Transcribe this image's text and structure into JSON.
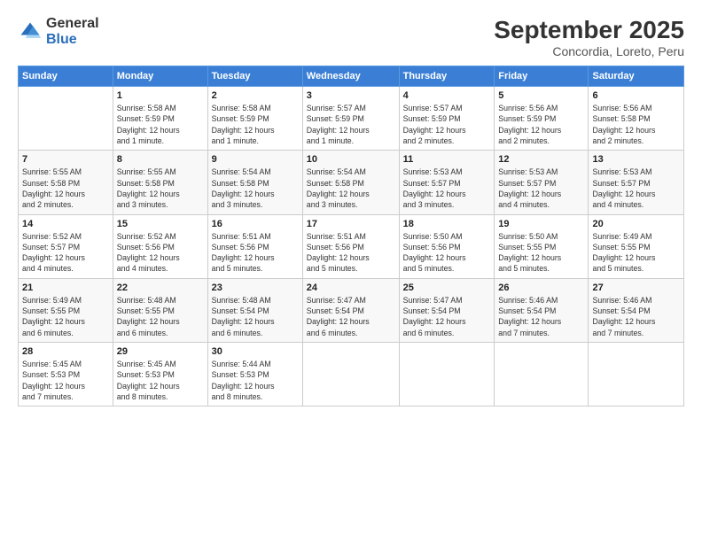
{
  "header": {
    "logo_general": "General",
    "logo_blue": "Blue",
    "month_title": "September 2025",
    "location": "Concordia, Loreto, Peru"
  },
  "weekdays": [
    "Sunday",
    "Monday",
    "Tuesday",
    "Wednesday",
    "Thursday",
    "Friday",
    "Saturday"
  ],
  "weeks": [
    [
      {
        "day": "",
        "info": ""
      },
      {
        "day": "1",
        "info": "Sunrise: 5:58 AM\nSunset: 5:59 PM\nDaylight: 12 hours\nand 1 minute."
      },
      {
        "day": "2",
        "info": "Sunrise: 5:58 AM\nSunset: 5:59 PM\nDaylight: 12 hours\nand 1 minute."
      },
      {
        "day": "3",
        "info": "Sunrise: 5:57 AM\nSunset: 5:59 PM\nDaylight: 12 hours\nand 1 minute."
      },
      {
        "day": "4",
        "info": "Sunrise: 5:57 AM\nSunset: 5:59 PM\nDaylight: 12 hours\nand 2 minutes."
      },
      {
        "day": "5",
        "info": "Sunrise: 5:56 AM\nSunset: 5:59 PM\nDaylight: 12 hours\nand 2 minutes."
      },
      {
        "day": "6",
        "info": "Sunrise: 5:56 AM\nSunset: 5:58 PM\nDaylight: 12 hours\nand 2 minutes."
      }
    ],
    [
      {
        "day": "7",
        "info": "Sunrise: 5:55 AM\nSunset: 5:58 PM\nDaylight: 12 hours\nand 2 minutes."
      },
      {
        "day": "8",
        "info": "Sunrise: 5:55 AM\nSunset: 5:58 PM\nDaylight: 12 hours\nand 3 minutes."
      },
      {
        "day": "9",
        "info": "Sunrise: 5:54 AM\nSunset: 5:58 PM\nDaylight: 12 hours\nand 3 minutes."
      },
      {
        "day": "10",
        "info": "Sunrise: 5:54 AM\nSunset: 5:58 PM\nDaylight: 12 hours\nand 3 minutes."
      },
      {
        "day": "11",
        "info": "Sunrise: 5:53 AM\nSunset: 5:57 PM\nDaylight: 12 hours\nand 3 minutes."
      },
      {
        "day": "12",
        "info": "Sunrise: 5:53 AM\nSunset: 5:57 PM\nDaylight: 12 hours\nand 4 minutes."
      },
      {
        "day": "13",
        "info": "Sunrise: 5:53 AM\nSunset: 5:57 PM\nDaylight: 12 hours\nand 4 minutes."
      }
    ],
    [
      {
        "day": "14",
        "info": "Sunrise: 5:52 AM\nSunset: 5:57 PM\nDaylight: 12 hours\nand 4 minutes."
      },
      {
        "day": "15",
        "info": "Sunrise: 5:52 AM\nSunset: 5:56 PM\nDaylight: 12 hours\nand 4 minutes."
      },
      {
        "day": "16",
        "info": "Sunrise: 5:51 AM\nSunset: 5:56 PM\nDaylight: 12 hours\nand 5 minutes."
      },
      {
        "day": "17",
        "info": "Sunrise: 5:51 AM\nSunset: 5:56 PM\nDaylight: 12 hours\nand 5 minutes."
      },
      {
        "day": "18",
        "info": "Sunrise: 5:50 AM\nSunset: 5:56 PM\nDaylight: 12 hours\nand 5 minutes."
      },
      {
        "day": "19",
        "info": "Sunrise: 5:50 AM\nSunset: 5:55 PM\nDaylight: 12 hours\nand 5 minutes."
      },
      {
        "day": "20",
        "info": "Sunrise: 5:49 AM\nSunset: 5:55 PM\nDaylight: 12 hours\nand 5 minutes."
      }
    ],
    [
      {
        "day": "21",
        "info": "Sunrise: 5:49 AM\nSunset: 5:55 PM\nDaylight: 12 hours\nand 6 minutes."
      },
      {
        "day": "22",
        "info": "Sunrise: 5:48 AM\nSunset: 5:55 PM\nDaylight: 12 hours\nand 6 minutes."
      },
      {
        "day": "23",
        "info": "Sunrise: 5:48 AM\nSunset: 5:54 PM\nDaylight: 12 hours\nand 6 minutes."
      },
      {
        "day": "24",
        "info": "Sunrise: 5:47 AM\nSunset: 5:54 PM\nDaylight: 12 hours\nand 6 minutes."
      },
      {
        "day": "25",
        "info": "Sunrise: 5:47 AM\nSunset: 5:54 PM\nDaylight: 12 hours\nand 6 minutes."
      },
      {
        "day": "26",
        "info": "Sunrise: 5:46 AM\nSunset: 5:54 PM\nDaylight: 12 hours\nand 7 minutes."
      },
      {
        "day": "27",
        "info": "Sunrise: 5:46 AM\nSunset: 5:54 PM\nDaylight: 12 hours\nand 7 minutes."
      }
    ],
    [
      {
        "day": "28",
        "info": "Sunrise: 5:45 AM\nSunset: 5:53 PM\nDaylight: 12 hours\nand 7 minutes."
      },
      {
        "day": "29",
        "info": "Sunrise: 5:45 AM\nSunset: 5:53 PM\nDaylight: 12 hours\nand 8 minutes."
      },
      {
        "day": "30",
        "info": "Sunrise: 5:44 AM\nSunset: 5:53 PM\nDaylight: 12 hours\nand 8 minutes."
      },
      {
        "day": "",
        "info": ""
      },
      {
        "day": "",
        "info": ""
      },
      {
        "day": "",
        "info": ""
      },
      {
        "day": "",
        "info": ""
      }
    ]
  ]
}
